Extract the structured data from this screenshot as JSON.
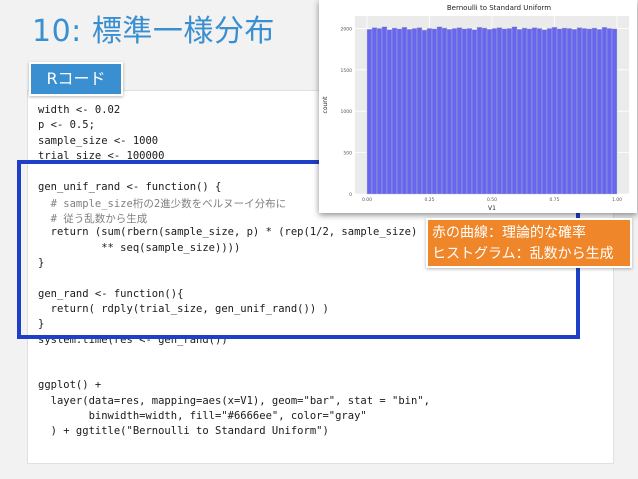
{
  "slide": {
    "title": "10: 標準一様分布",
    "tag": "Rコード",
    "note": [
      "赤の曲線：理論的な確率",
      "ヒストグラム：乱数から生成"
    ]
  },
  "code": {
    "lines": [
      "width <- 0.02",
      "p <- 0.5;",
      "sample_size <- 1000",
      "trial_size <- 100000",
      "",
      "gen_unif_rand <- function() {",
      "  # sample_size桁の2進少数をベルヌーイ分布に",
      "  # 従う乱数から生成",
      "  return (sum(rbern(sample_size, p) * (rep(1/2, sample_size)",
      "          ** seq(sample_size))))",
      "}",
      "",
      "gen_rand <- function(){",
      "  return( rdply(trial_size, gen_unif_rand()) )",
      "}",
      "system.time(res <- gen_rand())",
      "",
      "",
      "ggplot() +",
      "  layer(data=res, mapping=aes(x=V1), geom=\"bar\", stat = \"bin\",",
      "        binwidth=width, fill=\"#6666ee\", color=\"gray\"",
      "  ) + ggtitle(\"Bernoulli to Standard Uniform\")"
    ]
  },
  "chart_data": {
    "type": "bar",
    "title": "Bernoulli to Standard Uniform",
    "xlabel": "V1",
    "ylabel": "count",
    "x_ticks": [
      "0.00",
      "0.25",
      "0.50",
      "0.75",
      "1.00"
    ],
    "y_ticks": [
      "0",
      "500",
      "1000",
      "1500",
      "2000"
    ],
    "xlim": [
      0,
      1
    ],
    "ylim": [
      0,
      2150
    ],
    "bin_width": 0.02,
    "bar_color": "#6666ee",
    "grid": true,
    "values": [
      1990,
      2010,
      2000,
      2020,
      1985,
      2005,
      1995,
      2015,
      1990,
      2000,
      2010,
      1980,
      2000,
      1995,
      2020,
      2005,
      1990,
      2000,
      2010,
      1995,
      2000,
      1985,
      2015,
      2005,
      1990,
      2000,
      2010,
      1995,
      2000,
      2020,
      1990,
      2005,
      1995,
      2010,
      2000,
      1985,
      2000,
      2015,
      1995,
      2005,
      2000,
      1990,
      2010,
      2000,
      1995,
      2005,
      1990,
      2015,
      2000,
      1995
    ]
  }
}
